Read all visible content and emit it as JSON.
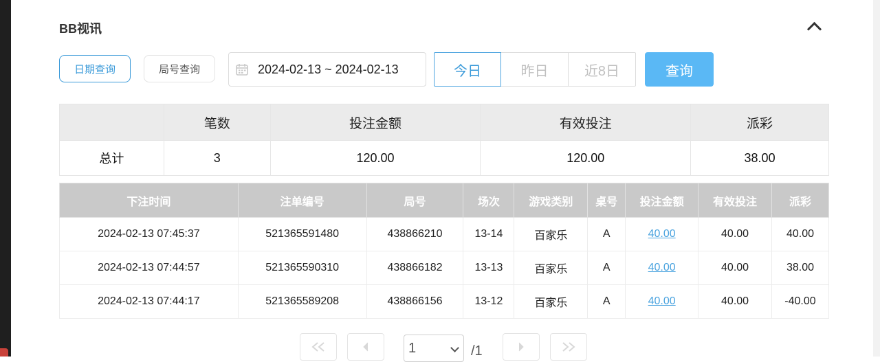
{
  "section": {
    "title": "BB视讯"
  },
  "filters": {
    "mode_date_label": "日期查询",
    "mode_round_label": "局号查询",
    "date_range": "2024-02-13 ~ 2024-02-13",
    "quick": [
      "今日",
      "昨日",
      "近8日"
    ],
    "query_label": "查询"
  },
  "summary": {
    "headers": [
      "",
      "笔数",
      "投注金额",
      "有效投注",
      "派彩"
    ],
    "row": [
      "总计",
      "3",
      "120.00",
      "120.00",
      "38.00"
    ]
  },
  "detail": {
    "headers": [
      "下注时间",
      "注单编号",
      "局号",
      "场次",
      "游戏类别",
      "桌号",
      "投注金额",
      "有效投注",
      "派彩"
    ],
    "rows": [
      [
        "2024-02-13 07:45:37",
        "521365591480",
        "438866210",
        "13-14",
        "百家乐",
        "A",
        "40.00",
        "40.00",
        "40.00"
      ],
      [
        "2024-02-13 07:44:57",
        "521365590310",
        "438866182",
        "13-13",
        "百家乐",
        "A",
        "40.00",
        "40.00",
        "38.00"
      ],
      [
        "2024-02-13 07:44:17",
        "521365589208",
        "438866156",
        "13-12",
        "百家乐",
        "A",
        "40.00",
        "40.00",
        "-40.00"
      ]
    ]
  },
  "pagination": {
    "current_page": "1",
    "total_label": "/1"
  },
  "colors": {
    "accent": "#3a9ad9",
    "query_button": "#5ab8f5",
    "negative": "#e84b4b",
    "header_gray": "#c9c9c9"
  }
}
